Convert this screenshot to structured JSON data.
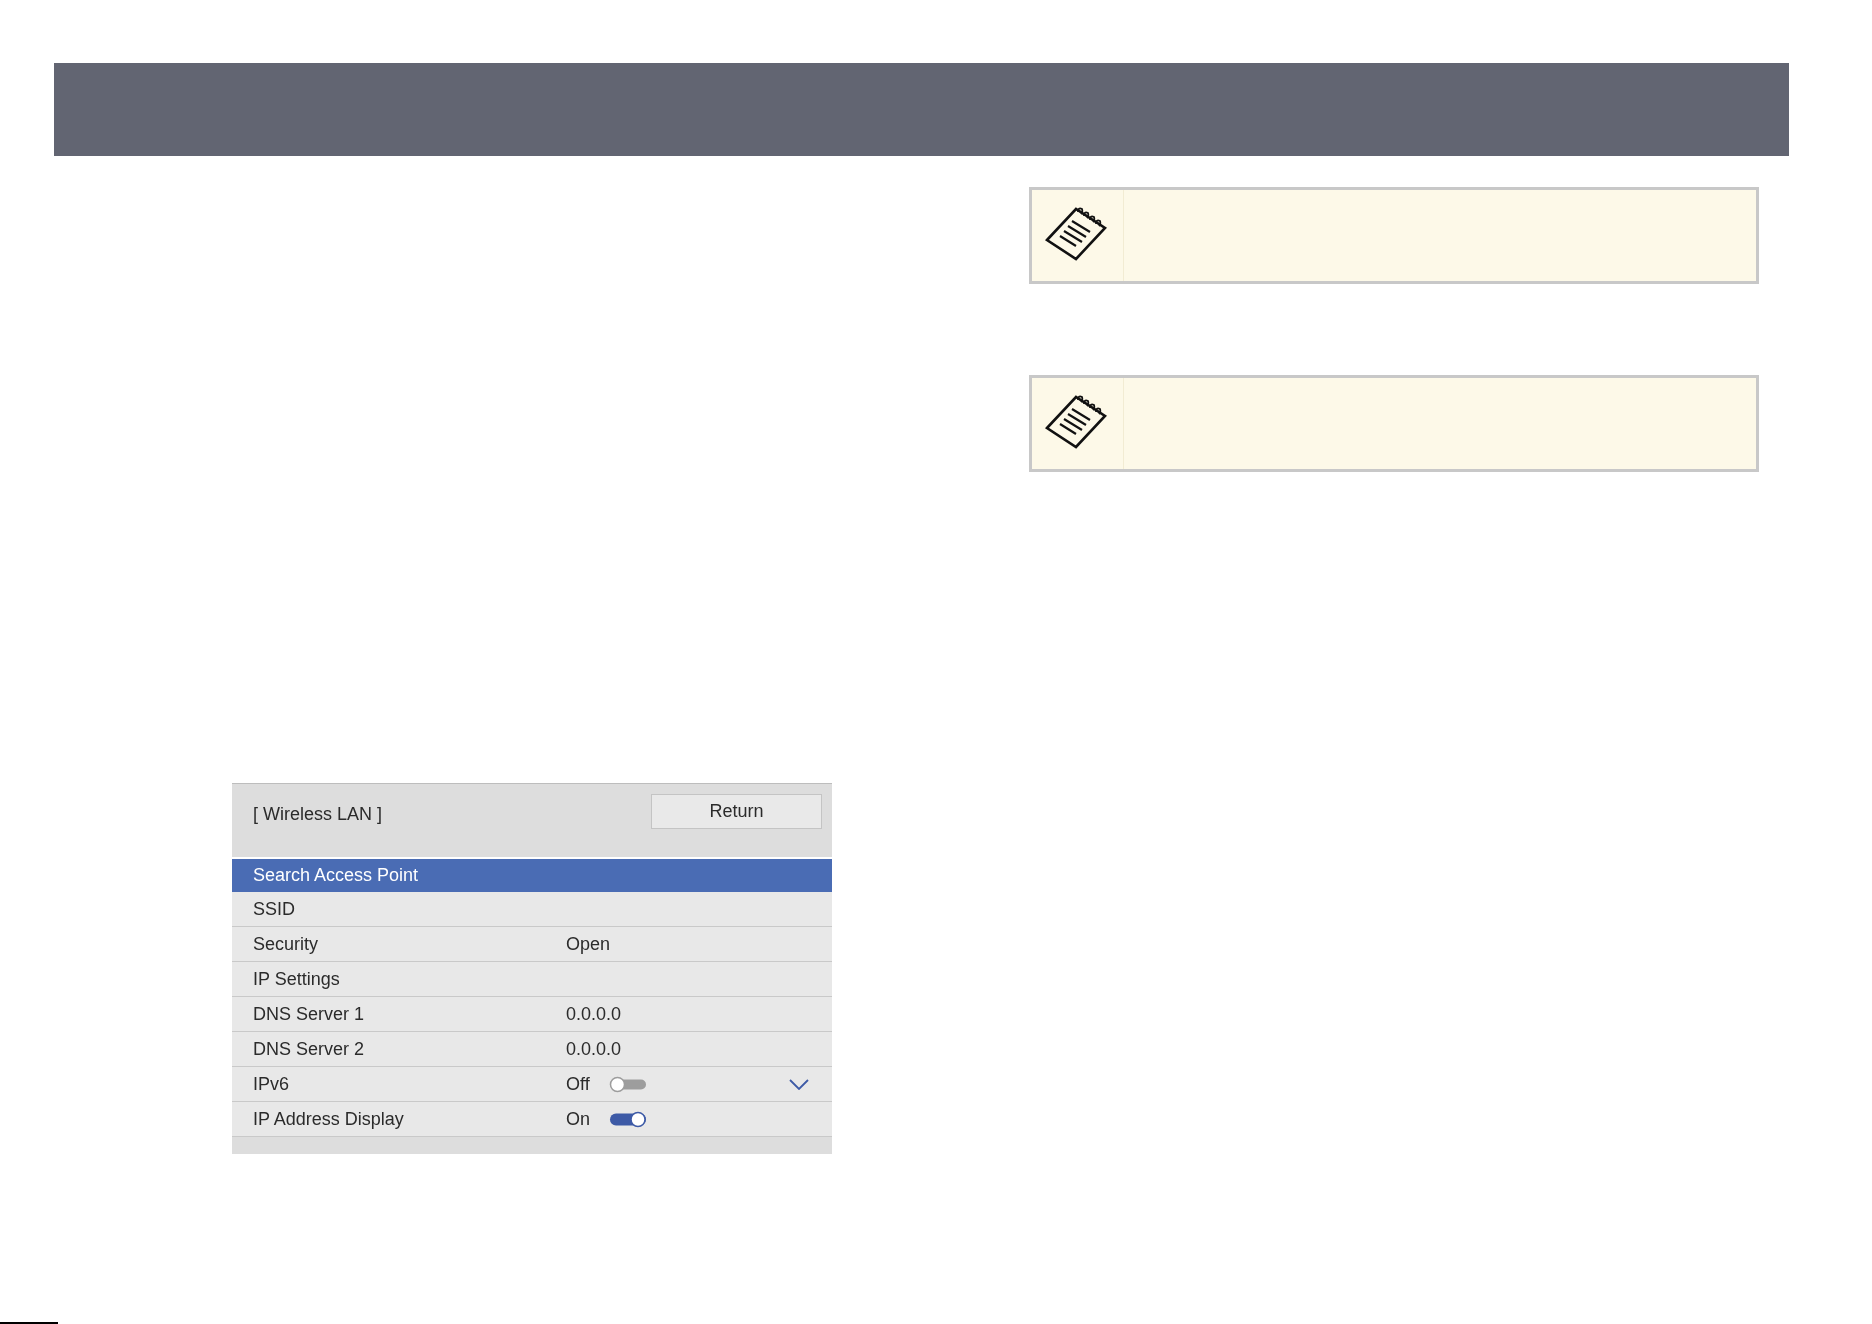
{
  "notes": [
    {
      "kind": "note"
    },
    {
      "kind": "note"
    }
  ],
  "menu": {
    "title": "[ Wireless LAN ]",
    "return_button": "Return",
    "items": [
      {
        "kind": "plain",
        "label": "Search Access Point",
        "selected": true,
        "chevron": false
      },
      {
        "kind": "plain",
        "label": "SSID",
        "selected": false,
        "chevron": false
      },
      {
        "kind": "value",
        "label": "Security",
        "value": "Open",
        "selected": false,
        "chevron": false
      },
      {
        "kind": "plain",
        "label": "IP Settings",
        "selected": false,
        "chevron": false
      },
      {
        "kind": "value",
        "label": "DNS Server 1",
        "value": "0.0.0.0",
        "selected": false,
        "chevron": false
      },
      {
        "kind": "value",
        "label": "DNS Server 2",
        "value": "0.0.0.0",
        "selected": false,
        "chevron": false
      },
      {
        "kind": "toggle",
        "label": "IPv6",
        "value": "Off",
        "on": false,
        "selected": false,
        "chevron": true
      },
      {
        "kind": "toggle",
        "label": "IP Address Display",
        "value": "On",
        "on": true,
        "selected": false,
        "chevron": false
      }
    ]
  }
}
